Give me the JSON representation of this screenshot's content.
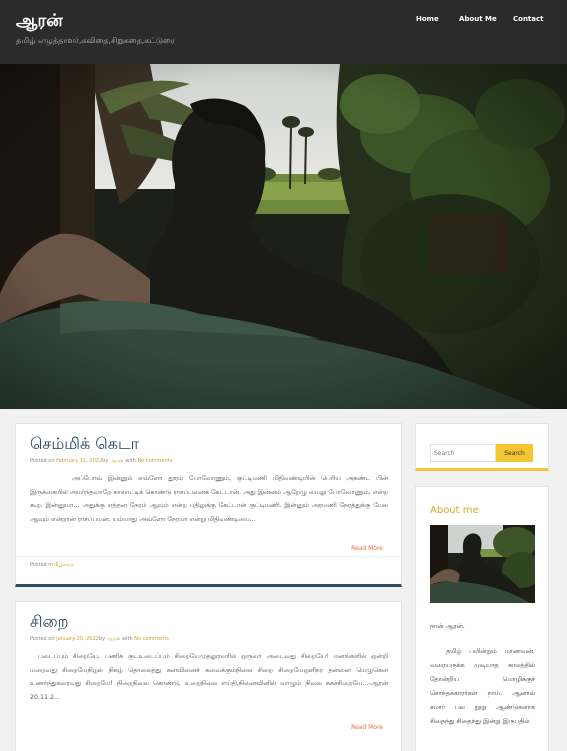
{
  "site": {
    "title": "ஆரன்",
    "description": "தமிழ் எழுத்தாளர்,கவிதை,சிறுகதை,கட்டுரை"
  },
  "nav": [
    {
      "label": "Home"
    },
    {
      "label": "About Me"
    },
    {
      "label": "Contact"
    }
  ],
  "posts": [
    {
      "title": "செம்மிக் கெடா",
      "meta": {
        "posted_on": "Posted on",
        "date": "February 11, 2022",
        "by": "by",
        "author": "ஆரன்",
        "with": "with",
        "comments": "No comments"
      },
      "excerpt": "அப்போவ் இன்னும் எவ்ளோ தூரம் போவோணும், குட்டிமணி மிதிவண்டியின் பெரிய அகண்ட பின் இருக்கையில் அமர்ந்தவாறே காலாட்டிக் கொண்டு ராசப்பனைக் கேட்டான். அது இன்னம் ஆறேழு மைலு போவோணும், என்ற கூற. இன்னுமா… அதுக்கு எத்தன நேரம் ஆவும் என்ற பதிலுக்கு கேட்டான் குட்டிமணி. இன்னும் அரமணி நேரத்துக்கு மேல ஆவும் என்றான் ராசப்பயன்.  யம்மாது அவ்ளோ நேரமா என்று மிதிவண்டியை...",
      "read_more": "Read More",
      "posted_in_label": "Posted in",
      "category": "சிறுகதை"
    },
    {
      "title": "சிறை",
      "meta": {
        "posted_on": "Posted on",
        "date": "January 20, 2022",
        "by": "by",
        "author": "ஆரன்",
        "with": "with",
        "comments": "No comments"
      },
      "excerpt": "படைப்பும் சிறையே, பணிக் குடஉடைப்பும் சிறையேமுதலுரவரில் ஒருவர் அடைவது சிறையே! மனங்களில் ஒன்றி மறைவது சிறையேநிழல் நிகழ் தொலைத்து கனவினைச் சுவைக்கும்நிலை சிறை சிறையேஒளிநர தன்னை மெழுகென உணர்ந்துகரைவது சிறையே! நிறைநிலை கொண்டு, உறைநிலை எய்தி,நினைவினில் வாழும் நிலை சுகச்சிறையே...-ஆரன் 20.11.2...",
      "read_more": "Read More"
    }
  ],
  "sidebar": {
    "search": {
      "placeholder": "Search",
      "button": "Search"
    },
    "about": {
      "title": "About me",
      "p1": "நான் ஆரன்.",
      "p2": "தமிழ் பயின்றும் மாணவன். வரையருக்க முடியாத காலத்தில் தோன்றிய மொழிக்குச் சொந்தக்காரர்கள் நாம். ஆனால் சமார் பல நூறு ஆண்டுகளாக சிதைந்து சிதைந்து இன்று இருபதில்"
    }
  },
  "colors": {
    "accent": "#f6c632",
    "title": "#1f3f57",
    "link": "#e0703a",
    "topbar": "#2b2b2b"
  }
}
